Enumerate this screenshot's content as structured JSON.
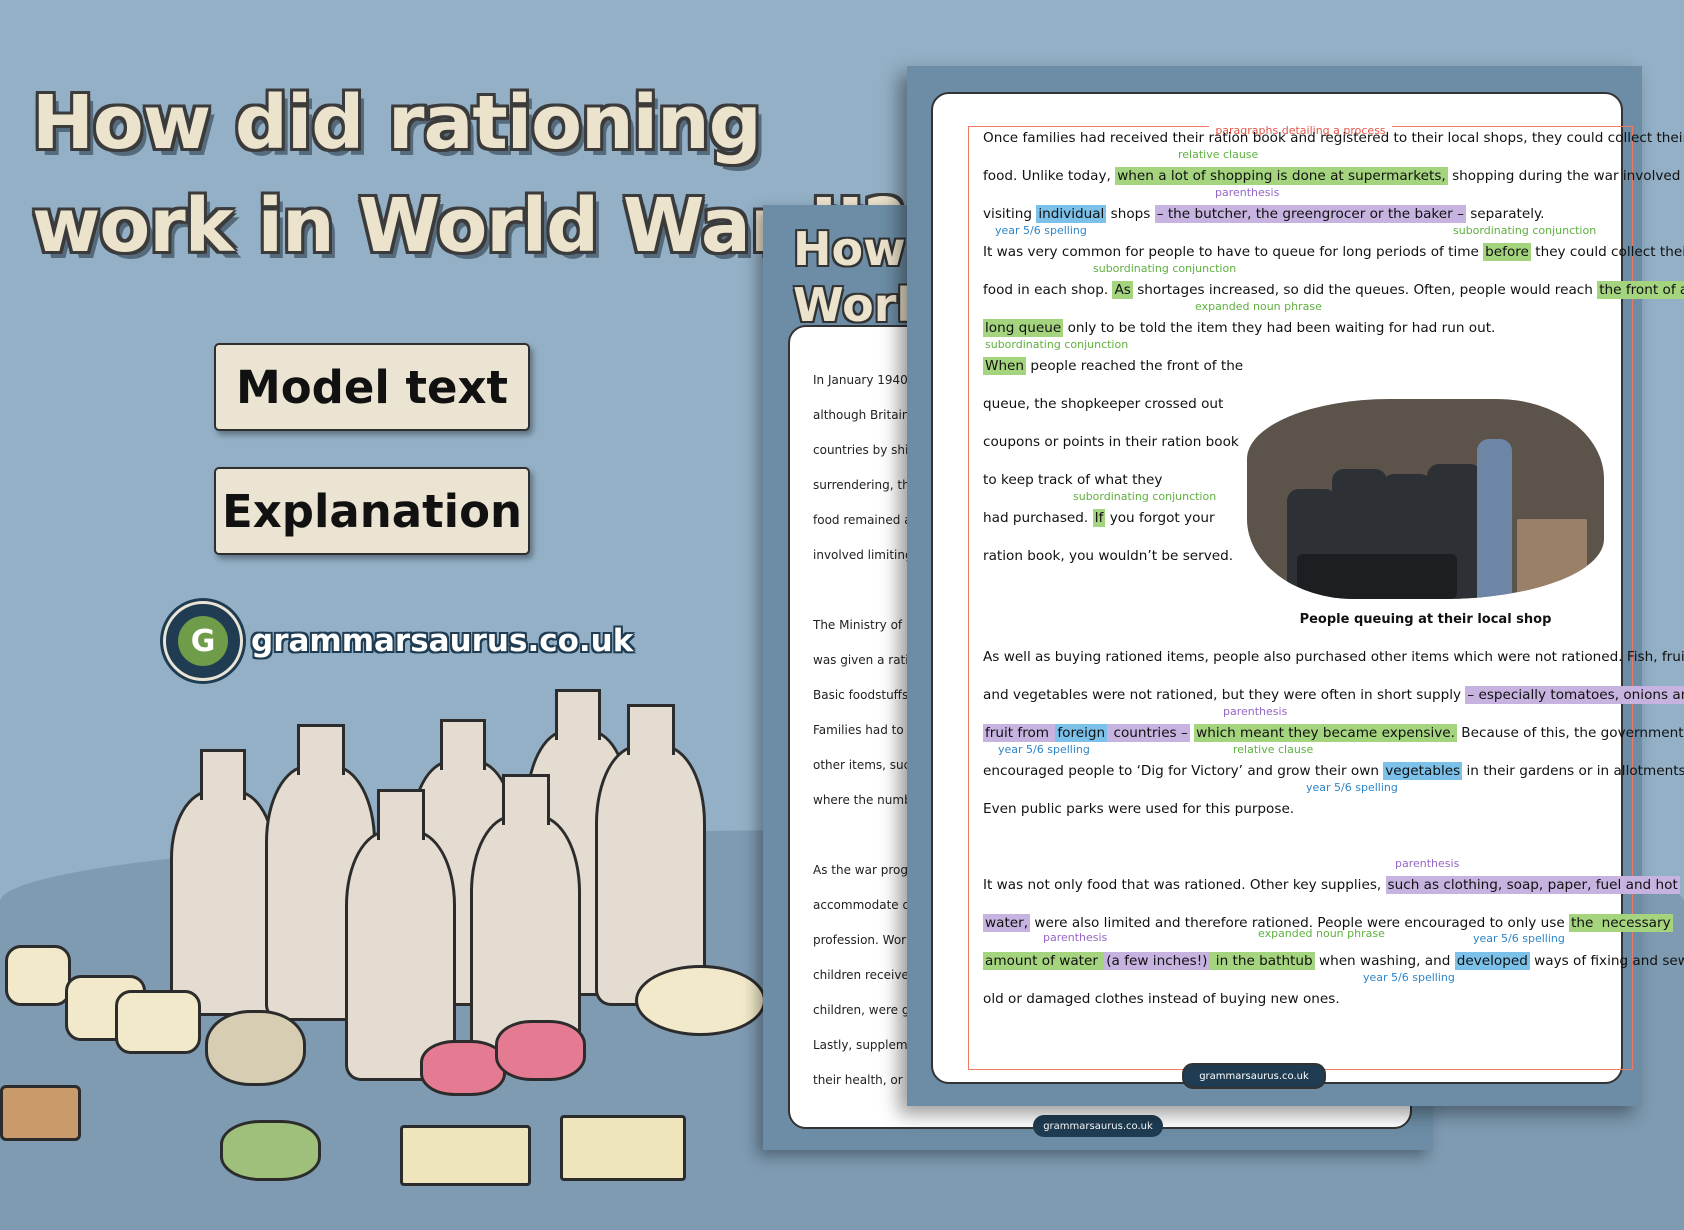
{
  "cover": {
    "title_line1": "How did rationing",
    "title_line2": "work in World War II?",
    "button_model": "Model text",
    "button_explanation": "Explanation",
    "logo_text": "grammarsaurus.co.uk",
    "logo_letter": "G"
  },
  "back_page": {
    "title_line1": "How",
    "title_line2": "World",
    "lines": [
      "In January 1940",
      "although Britain",
      "countries by ship",
      "surrendering, the",
      "food remained av",
      "involved limiting",
      "The Ministry of F",
      "was given a ration",
      "Basic foodstuffs",
      "Families had to r",
      "other items, such",
      "where the numbe",
      "As the war progr",
      "accommodate di",
      "profession. Work",
      "children received",
      "children, were giv",
      "Lastly, suppleme",
      "their health, or t"
    ],
    "footer_logo": "grammarsaurus.co.uk"
  },
  "front_page": {
    "section_title": "paragraphs detailing a process",
    "p1": {
      "l1": "Once families had received their ration book and registered to their local shops, they could collect their",
      "l2a": "food. Unlike today, ",
      "l2b": "when a lot of shopping is done at supermarkets,",
      "l2c": " shopping during the war involved",
      "l3a": "visiting ",
      "l3b": "individual",
      "l3c": " shops ",
      "l3d": "– the butcher, the greengrocer or the baker –",
      "l3e": " separately.",
      "l4a": "It was very common for people to have to queue for long periods of time ",
      "l4b": "before",
      "l4c": " they could collect their",
      "l5a": "food in each shop. ",
      "l5b": "As",
      "l5c": " shortages increased, so did the queues. Often, people would reach ",
      "l5d": "the front of a",
      "l6a": "long queue",
      "l6b": " only to be told the item they had been waiting for had run out.",
      "l7a": "When",
      "l7b": " people reached the front of the",
      "l8": "queue, the shopkeeper crossed out",
      "l9": "coupons or points in their ration book",
      "l10": "to keep track of what they",
      "l11a": "had purchased. ",
      "l11b": "If",
      "l11c": " you forgot your",
      "l12": "ration book, you wouldn’t be served."
    },
    "p1_annotations": {
      "relative_clause": "relative clause",
      "parenthesis": "parenthesis",
      "spelling": "year 5/6 spelling",
      "sub_conj1": "subordinating conjunction",
      "sub_conj2": "subordinating conjunction",
      "noun_phrase": "expanded noun phrase",
      "sub_conj3": "subordinating conjunction",
      "sub_conj4": "subordinating conjunction"
    },
    "caption": "People queuing at their local shop",
    "p2": {
      "l1": "As well as buying rationed items, people also purchased other items which were not rationed. Fish, fruit",
      "l2a": "and vegetables were not rationed, but they were often in short supply ",
      "l2b": "– especially tomatoes, onions and",
      "l3a": "fruit from ",
      "l3b": "foreign",
      "l3c": " countries –",
      "l3d": " ",
      "l3e": "which meant they became expensive.",
      "l3f": " Because of this, the government",
      "l4a": "encouraged people to ‘Dig for Victory’ and grow their own ",
      "l4b": "vegetables",
      "l4c": " in their gardens or in allotments.",
      "l5": "Even public parks were used for this purpose."
    },
    "p2_annotations": {
      "parenthesis": "parenthesis",
      "spelling1": "year 5/6 spelling",
      "relative_clause": "relative clause",
      "spelling2": "year 5/6 spelling"
    },
    "p3": {
      "l1a": "It was not only food that was rationed. Other key supplies, ",
      "l1b": "such as clothing, soap, paper, fuel and hot",
      "l2a": "water,",
      "l2b": " were also limited and therefore rationed. People were encouraged to only use ",
      "l2c": "the ",
      "l2d": "necessary",
      "l3a": "amount of water ",
      "l3b": "(a few inches!)",
      "l3c": " in the bathtub",
      "l3d": " when washing, and ",
      "l3e": "developed",
      "l3f": " ways of fixing and sewing",
      "l4": "old or damaged clothes instead of buying new ones."
    },
    "p3_annotations": {
      "parenthesis1": "parenthesis",
      "spelling1": "year 5/6 spelling",
      "parenthesis2": "parenthesis",
      "noun_phrase": "expanded noun phrase",
      "spelling2": "year 5/6 spelling"
    },
    "footer_logo": "grammarsaurus.co.uk"
  },
  "colors": {
    "background": "#93b0c6",
    "highlight_green": "#a5d47f",
    "highlight_purple": "#c7b3e0",
    "highlight_blue": "#7cc1ea",
    "frame_red": "#ec7a67",
    "brand_navy": "#1f3c52"
  }
}
